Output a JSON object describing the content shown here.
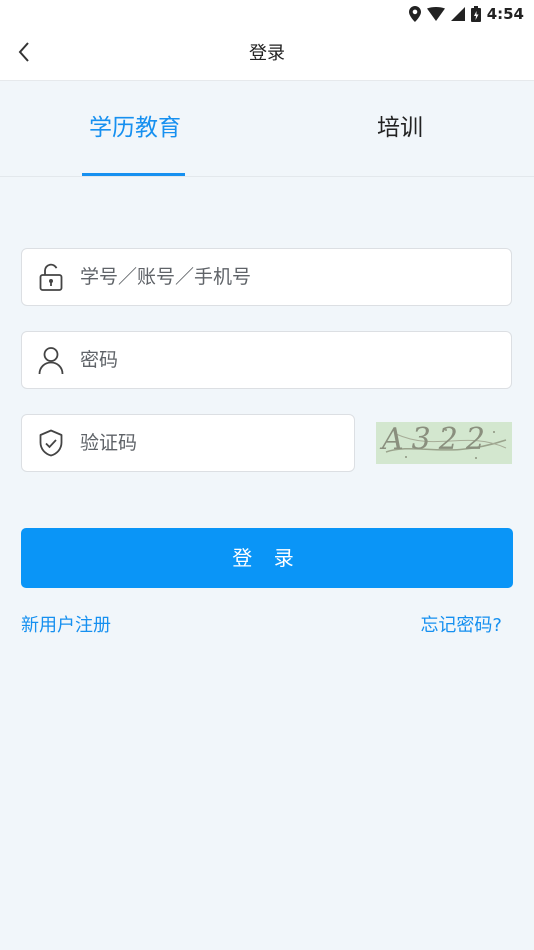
{
  "status_bar": {
    "time": "4:54",
    "icons": [
      "location-icon",
      "wifi-icon",
      "signal-icon",
      "battery-icon"
    ]
  },
  "header": {
    "title": "登录",
    "back_icon": "chevron-left-icon"
  },
  "tabs": [
    {
      "label": "学历教育",
      "active": true
    },
    {
      "label": "培训",
      "active": false
    }
  ],
  "form": {
    "account": {
      "placeholder": "学号／账号／手机号",
      "value": "",
      "icon": "lock-icon"
    },
    "password": {
      "placeholder": "密码",
      "value": "",
      "icon": "user-icon"
    },
    "captcha": {
      "placeholder": "验证码",
      "value": "",
      "icon": "shield-check-icon",
      "image_text": "A322"
    },
    "login_label": "登 录"
  },
  "links": {
    "register": "新用户注册",
    "forgot": "忘记密码?"
  },
  "colors": {
    "accent": "#0a95f7",
    "link": "#1690f0",
    "background": "#f1f6fa"
  }
}
